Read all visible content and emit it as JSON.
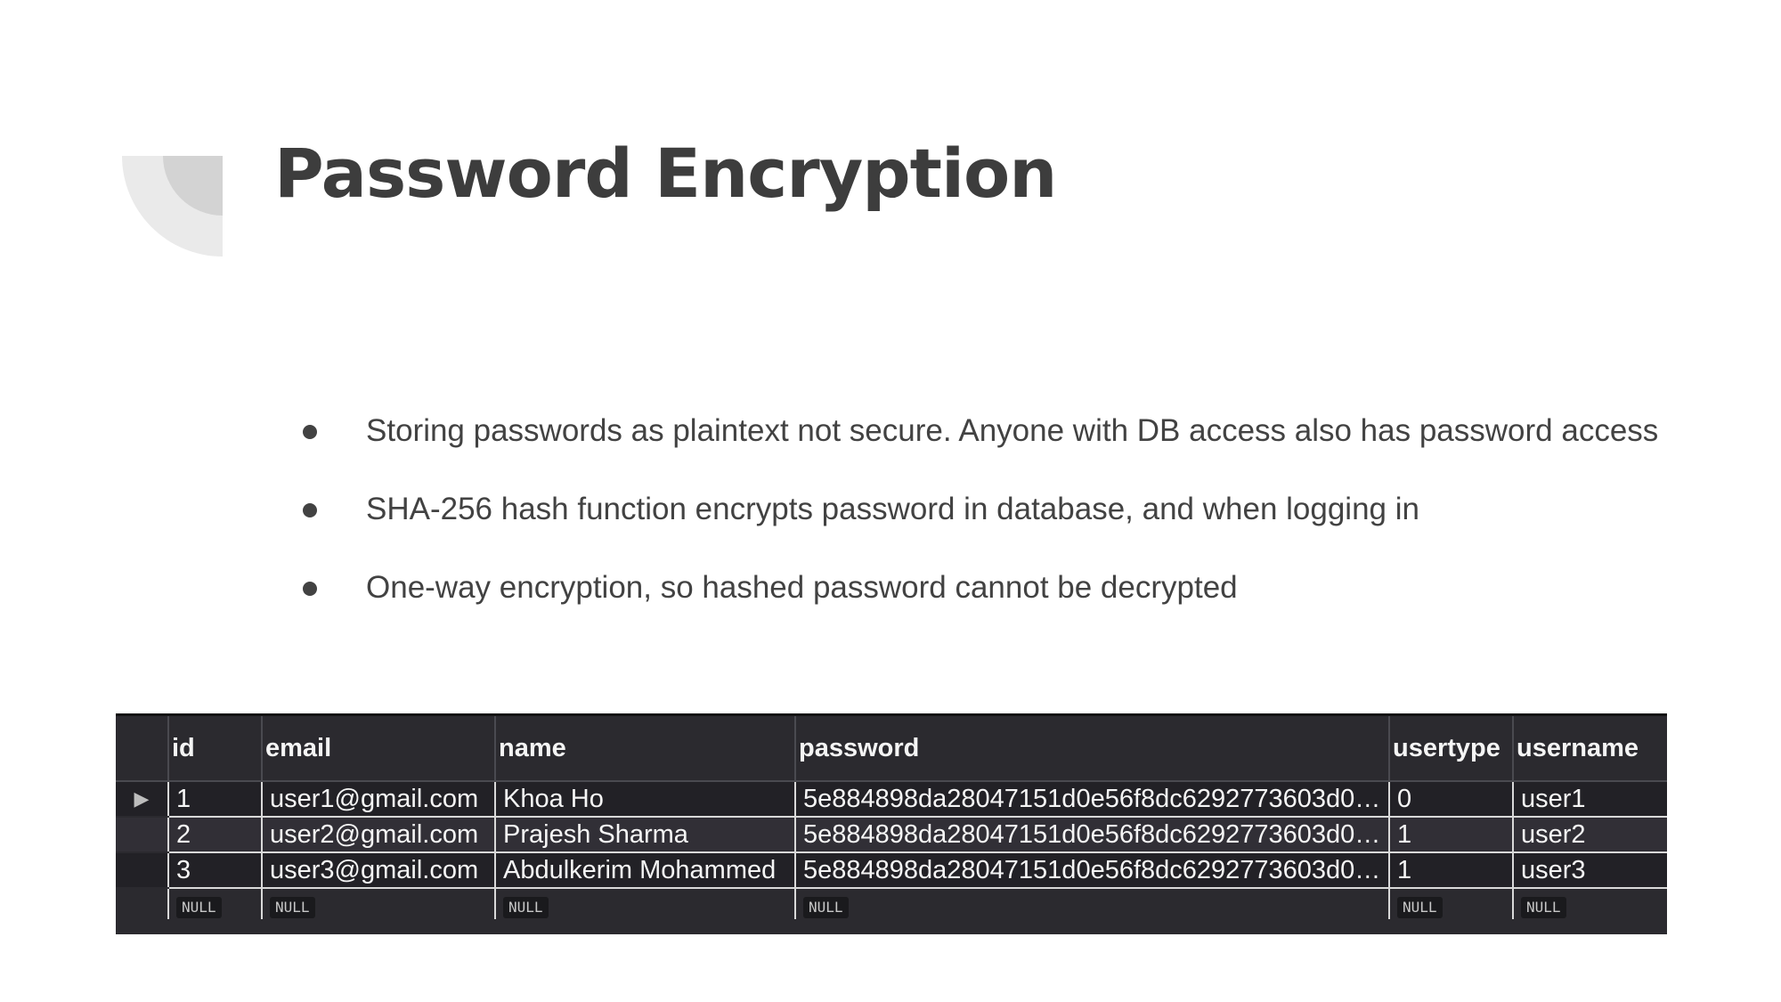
{
  "slide": {
    "title": "Password Encryption",
    "bullets": [
      "Storing passwords as plaintext not secure. Anyone with DB access also has password access",
      "SHA-256 hash function encrypts password in database, and when logging in",
      "One-way encryption, so hashed password cannot be decrypted"
    ]
  },
  "table": {
    "columns": [
      "id",
      "email",
      "name",
      "password",
      "usertype",
      "username"
    ],
    "rows": [
      {
        "id": "1",
        "email": "user1@gmail.com",
        "name": "Khoa Ho",
        "password": "5e884898da28047151d0e56f8dc6292773603d0…",
        "usertype": "0",
        "username": "user1"
      },
      {
        "id": "2",
        "email": "user2@gmail.com",
        "name": "Prajesh Sharma",
        "password": "5e884898da28047151d0e56f8dc6292773603d0…",
        "usertype": "1",
        "username": "user2"
      },
      {
        "id": "3",
        "email": "user3@gmail.com",
        "name": "Abdulkerim Mohammed",
        "password": "5e884898da28047151d0e56f8dc6292773603d0…",
        "usertype": "1",
        "username": "user3"
      }
    ],
    "null_label": "NULL",
    "current_row_marker": "▶"
  }
}
